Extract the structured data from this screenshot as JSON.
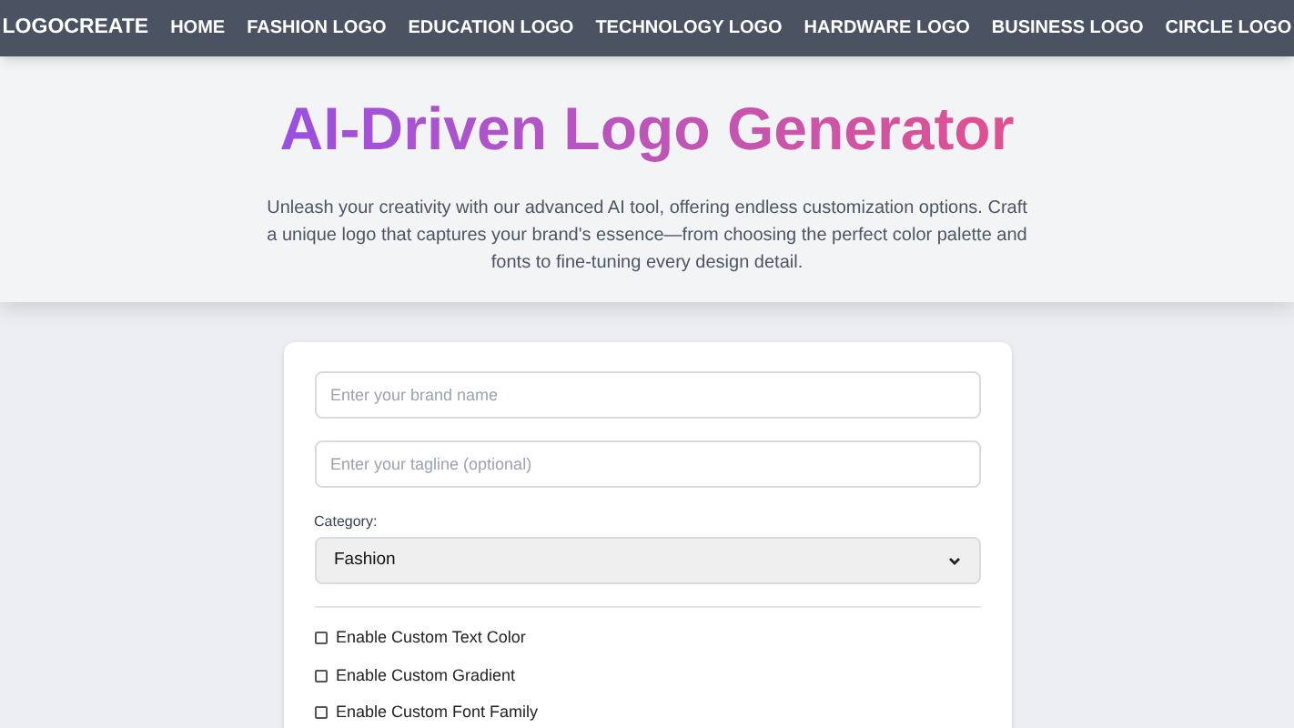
{
  "nav": {
    "brand": "LOGOCREATE",
    "links": [
      "HOME",
      "FASHION LOGO",
      "EDUCATION LOGO",
      "TECHNOLOGY LOGO",
      "HARDWARE LOGO",
      "BUSINESS LOGO",
      "CIRCLE LOGO"
    ]
  },
  "hero": {
    "title": "AI-Driven Logo Generator",
    "description": "Unleash your creativity with our advanced AI tool, offering endless customization options. Craft a unique logo that captures your brand's essence—from choosing the perfect color palette and fonts to fine-tuning every design detail."
  },
  "form": {
    "brand_field": {
      "placeholder": "Enter your brand name"
    },
    "tagline_field": {
      "placeholder": "Enter your tagline (optional)"
    },
    "category": {
      "label": "Category:",
      "value": "Fashion"
    },
    "options": [
      {
        "label": "Enable Custom Text Color",
        "checked": false
      },
      {
        "label": "Enable Custom Gradient",
        "checked": false
      },
      {
        "label": "Enable Custom Font Family",
        "checked": false
      }
    ]
  }
}
